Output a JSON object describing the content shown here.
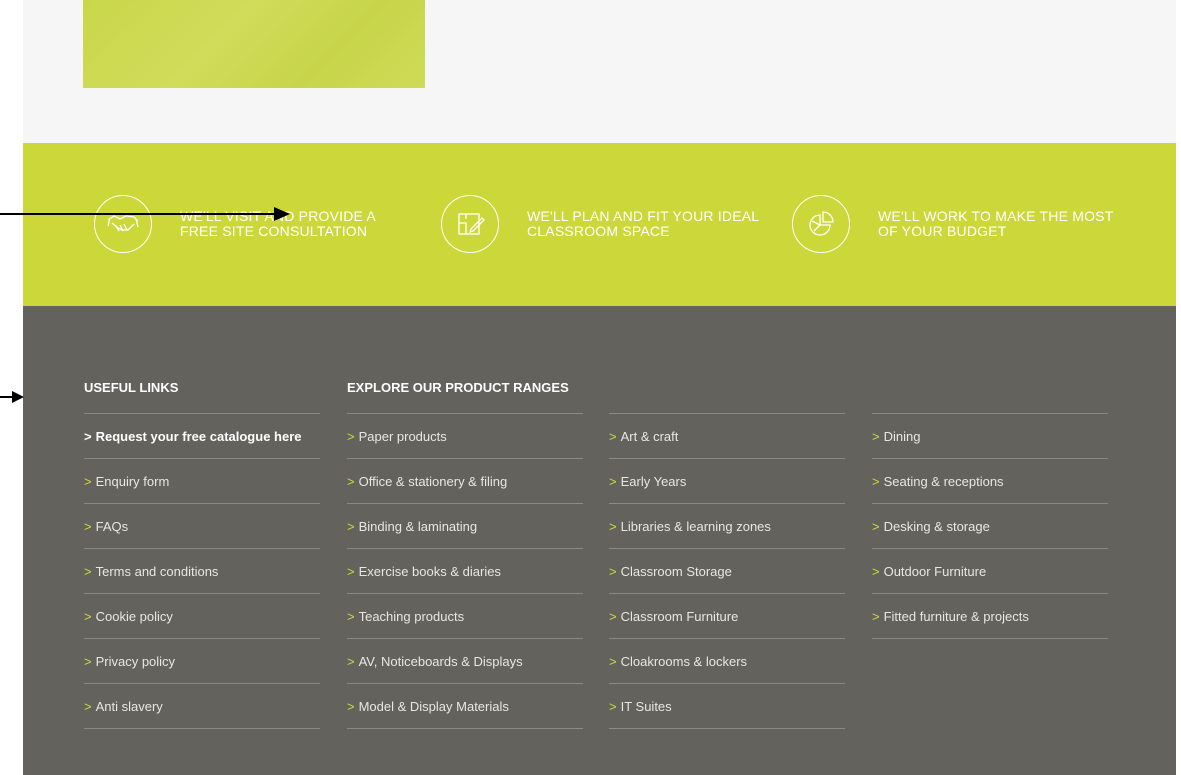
{
  "benefits": [
    {
      "icon": "handshake-icon",
      "text": "WE'LL VISIT AND PROVIDE A\nFREE SITE CONSULTATION"
    },
    {
      "icon": "floorplan-pencil-icon",
      "text": "WE'LL PLAN AND FIT YOUR IDEAL\nCLASSROOM SPACE"
    },
    {
      "icon": "pie-chart-icon",
      "text": "WE'LL WORK TO MAKE THE MOST\nOF YOUR BUDGET"
    }
  ],
  "footer": {
    "useful_links_title": "USEFUL LINKS",
    "explore_title": "EXPLORE OUR PRODUCT RANGES",
    "useful_links": [
      "Request your free catalogue here",
      "Enquiry form",
      "FAQs",
      "Terms and conditions",
      "Cookie policy",
      "Privacy policy",
      "Anti slavery"
    ],
    "ranges_col1": [
      "Paper products",
      "Office & stationery & filing",
      "Binding & laminating",
      "Exercise books & diaries",
      "Teaching products",
      "AV, Noticeboards & Displays",
      "Model & Display Materials"
    ],
    "ranges_col2": [
      "Art & craft",
      "Early Years",
      "Libraries & learning zones",
      "Classroom Storage",
      "Classroom Furniture",
      "Cloakrooms & lockers",
      "IT Suites"
    ],
    "ranges_col3": [
      "Dining",
      "Seating & receptions",
      "Desking & storage",
      "Outdoor Furniture",
      "Fitted furniture & projects"
    ]
  },
  "colors": {
    "accent_green": "#ccd83a",
    "footer_bg": "#64625c",
    "top_bg": "#f6f6f6"
  }
}
